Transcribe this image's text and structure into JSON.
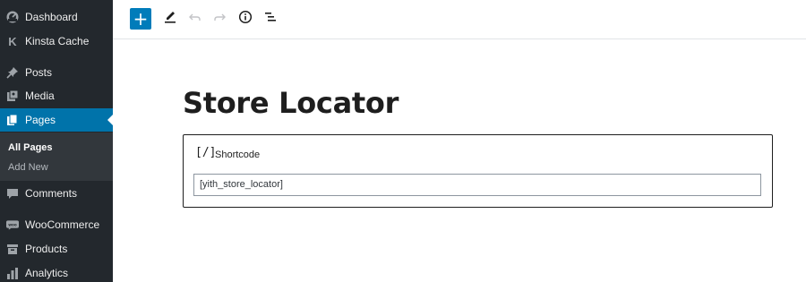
{
  "sidebar": {
    "items": [
      {
        "label": "Dashboard",
        "icon": "dashboard-icon"
      },
      {
        "label": "Kinsta Cache",
        "icon": "kinsta-icon"
      },
      {
        "label": "Posts",
        "icon": "pin-icon"
      },
      {
        "label": "Media",
        "icon": "media-icon"
      },
      {
        "label": "Pages",
        "icon": "pages-icon",
        "current": true
      },
      {
        "label": "Comments",
        "icon": "comment-icon"
      },
      {
        "label": "WooCommerce",
        "icon": "woo-icon"
      },
      {
        "label": "Products",
        "icon": "archive-icon"
      },
      {
        "label": "Analytics",
        "icon": "chart-bar-icon"
      }
    ],
    "submenu": {
      "all_pages": "All Pages",
      "add_new": "Add New"
    },
    "kinsta_glyph": "K",
    "woo_glyph": "woo"
  },
  "toolbar": {
    "buttons": [
      "add-block",
      "tools",
      "undo",
      "redo",
      "info",
      "outline"
    ],
    "add_glyph": "+"
  },
  "editor": {
    "title": "Store Locator",
    "block": {
      "icon_glyph": "[/]",
      "label": "Shortcode",
      "value": "[yith_store_locator]"
    }
  },
  "colors": {
    "sidebar_bg": "#23282d",
    "submenu_bg": "#32373c",
    "accent": "#0073aa",
    "primary_button": "#007cba"
  }
}
